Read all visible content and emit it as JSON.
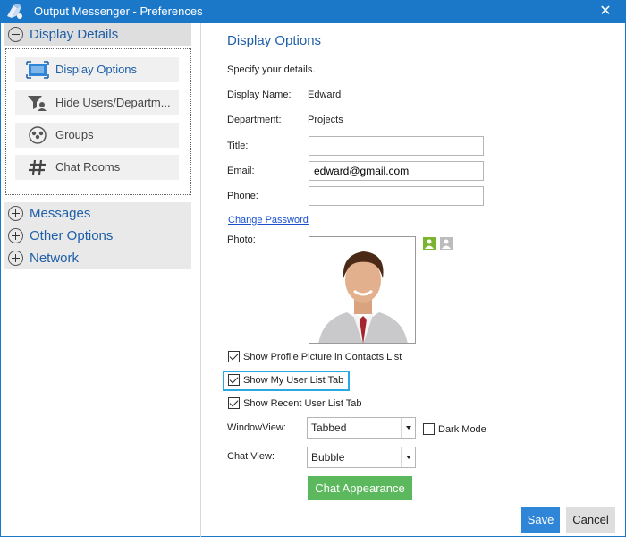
{
  "window": {
    "title": "Output Messenger - Preferences",
    "close_glyph": "✕",
    "app_icon": "messenger-logo-icon"
  },
  "sidebar": {
    "categories": [
      {
        "label": "Display Details",
        "state": "expanded"
      },
      {
        "label": "Messages",
        "state": "collapsed"
      },
      {
        "label": "Other Options",
        "state": "collapsed"
      },
      {
        "label": "Network",
        "state": "collapsed"
      }
    ],
    "sub_items": [
      {
        "label": "Display Options",
        "icon": "display-icon",
        "selected": true
      },
      {
        "label": "Hide Users/Departm...",
        "icon": "hide-users-icon"
      },
      {
        "label": "Groups",
        "icon": "groups-icon"
      },
      {
        "label": "Chat Rooms",
        "icon": "hash-icon"
      }
    ]
  },
  "main": {
    "title": "Display Options",
    "intro": "Specify your details.",
    "display_name_label": "Display Name:",
    "display_name_value": "Edward",
    "department_label": "Department:",
    "department_value": "Projects",
    "title_label": "Title:",
    "title_value": "",
    "email_label": "Email:",
    "email_value": "edward@gmail.com",
    "phone_label": "Phone:",
    "phone_value": "",
    "change_password": "Change Password",
    "photo_label": "Photo:",
    "checkboxes": [
      {
        "label": "Show Profile Picture in Contacts List",
        "checked": true
      },
      {
        "label": "Show My User List Tab",
        "checked": true,
        "focused": true
      },
      {
        "label": "Show Recent User List Tab",
        "checked": true
      }
    ],
    "window_view_label": "WindowView:",
    "window_view_value": "Tabbed",
    "dark_mode_label": "Dark Mode",
    "dark_mode_checked": false,
    "chat_view_label": "Chat View:",
    "chat_view_value": "Bubble",
    "chat_appearance_button": "Chat Appearance"
  },
  "footer": {
    "save": "Save",
    "cancel": "Cancel"
  },
  "colors": {
    "titlebar": "#1b78c9",
    "accent_text": "#1f5fa8",
    "save_button": "#2f86d8",
    "green_button": "#5cb85c",
    "focus_ring": "#2aa8e6"
  }
}
